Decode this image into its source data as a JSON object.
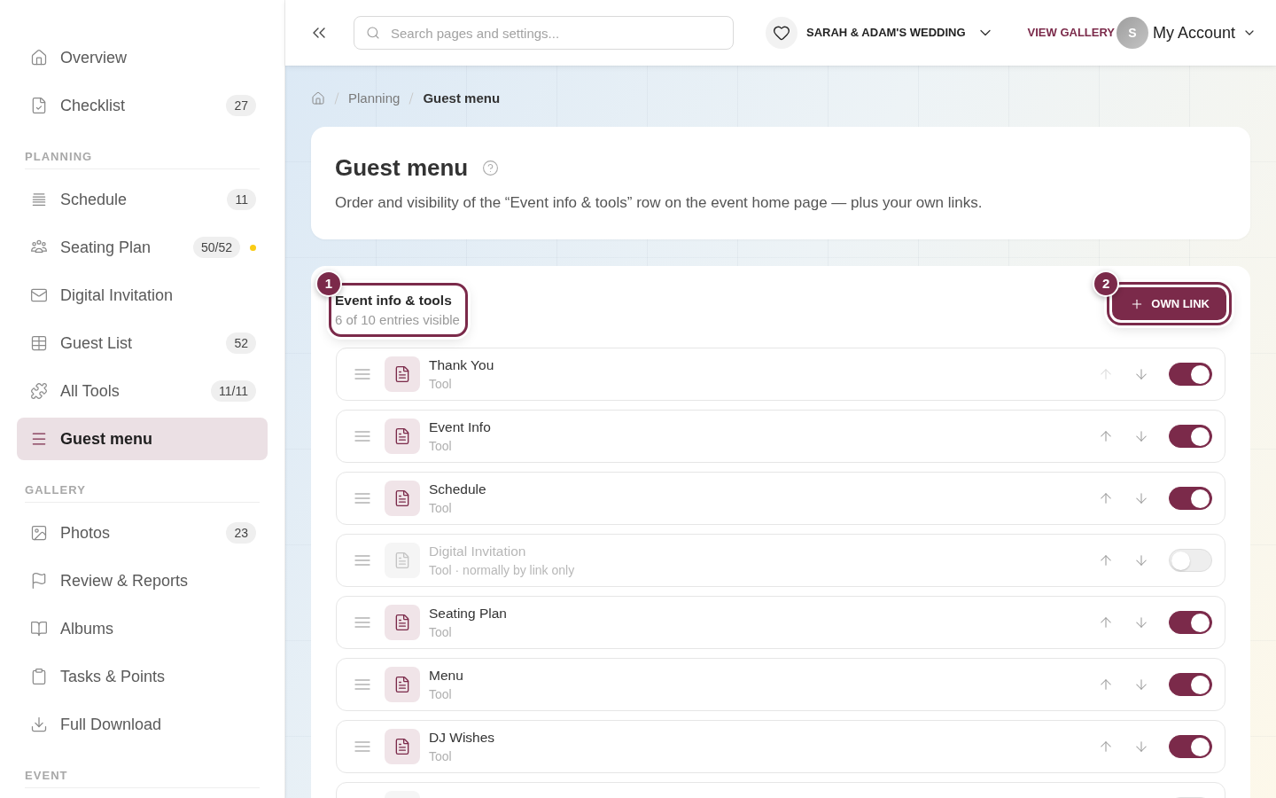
{
  "sidebar": {
    "sections": [
      {
        "items": [
          {
            "label": "Overview",
            "selected": false
          },
          {
            "label": "Checklist",
            "badge": "27",
            "selected": false
          }
        ]
      },
      {
        "heading": "PLANNING",
        "items": [
          {
            "label": "Schedule",
            "badge": "11",
            "selected": false
          },
          {
            "label": "Seating Plan",
            "badge": "50/52",
            "color": "#facc15",
            "selected": false
          },
          {
            "label": "Digital Invitation",
            "selected": false
          },
          {
            "label": "Guest List",
            "badge": "52",
            "selected": false
          },
          {
            "label": "All Tools",
            "badge": "11/11",
            "selected": false
          },
          {
            "label": "Guest menu",
            "selected": true
          }
        ]
      },
      {
        "heading": "GALLERY",
        "items": [
          {
            "label": "Photos",
            "badge": "23",
            "selected": false
          },
          {
            "label": "Review & Reports",
            "selected": false
          },
          {
            "label": "Albums",
            "selected": false
          },
          {
            "label": "Tasks & Points",
            "selected": false
          },
          {
            "label": "Full Download",
            "selected": false
          }
        ]
      },
      {
        "heading": "EVENT"
      }
    ]
  },
  "top_bar": {
    "search": {
      "placeholder": "Search pages and settings..."
    },
    "event_switcher": {
      "label": "SARAH & ADAM'S WEDDING"
    },
    "gallery_link": "VIEW GALLERY",
    "account": {
      "initial": "S",
      "label": "My Account"
    }
  },
  "breadcrumb": [
    {
      "label": "Planning",
      "current": false
    },
    {
      "label": "Guest menu",
      "current": true
    }
  ],
  "page_header": {
    "title": "Guest menu",
    "description": "Order and visibility of the “Event info & tools” row on the event home page — plus your own links."
  },
  "section": {
    "title": "Event info & tools",
    "subtitle": "6 of 10 entries visible",
    "step": "1"
  },
  "add_button": {
    "label": "OWN LINK",
    "step": "2"
  },
  "entries": [
    {
      "title": "Thank You",
      "subtitle": "Tool",
      "on": true,
      "up_disabled": true
    },
    {
      "title": "Event Info",
      "subtitle": "Tool",
      "on": true,
      "up_disabled": false
    },
    {
      "title": "Schedule",
      "subtitle": "Tool",
      "on": true,
      "up_disabled": false
    },
    {
      "title": "Digital Invitation",
      "subtitle": "Tool · normally by link only",
      "on": false,
      "up_disabled": false
    },
    {
      "title": "Seating Plan",
      "subtitle": "Tool",
      "on": true,
      "up_disabled": false
    },
    {
      "title": "Menu",
      "subtitle": "Tool",
      "on": true,
      "up_disabled": false
    },
    {
      "title": "DJ Wishes",
      "subtitle": "Tool",
      "on": true,
      "up_disabled": false
    },
    {
      "on": false
    }
  ]
}
